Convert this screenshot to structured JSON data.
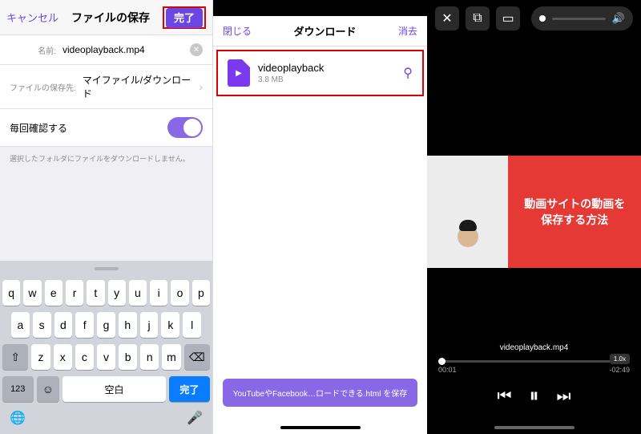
{
  "panel1": {
    "cancel": "キャンセル",
    "title": "ファイルの保存",
    "done": "完了",
    "name_label": "名前:",
    "filename": "videoplayback.mp4",
    "location_label": "ファイルの保存先:",
    "location_value": "マイファイル/ダウンロード",
    "confirm_label": "毎回確認する",
    "note": "選択したフォルダにファイルをダウンロードしません。",
    "keyboard": {
      "row1": [
        "q",
        "w",
        "e",
        "r",
        "t",
        "y",
        "u",
        "i",
        "o",
        "p"
      ],
      "row2": [
        "a",
        "s",
        "d",
        "f",
        "g",
        "h",
        "j",
        "k",
        "l"
      ],
      "row3_shift": "⇧",
      "row3": [
        "z",
        "x",
        "c",
        "v",
        "b",
        "n",
        "m"
      ],
      "row3_del": "⌫",
      "numkey": "123",
      "space": "空白",
      "done": "完了"
    }
  },
  "panel2": {
    "close": "閉じる",
    "title": "ダウンロード",
    "clear": "消去",
    "file_name": "videoplayback",
    "file_size": "3.8 MB",
    "toast": "YouTubeやFacebook…ロードできる.html を保存"
  },
  "panel3": {
    "thumb_line1": "動画サイトの動画を",
    "thumb_line2": "保存する方法",
    "filename": "videoplayback.mp4",
    "elapsed": "00:01",
    "remaining": "-02:49",
    "speed": "1.0x"
  }
}
